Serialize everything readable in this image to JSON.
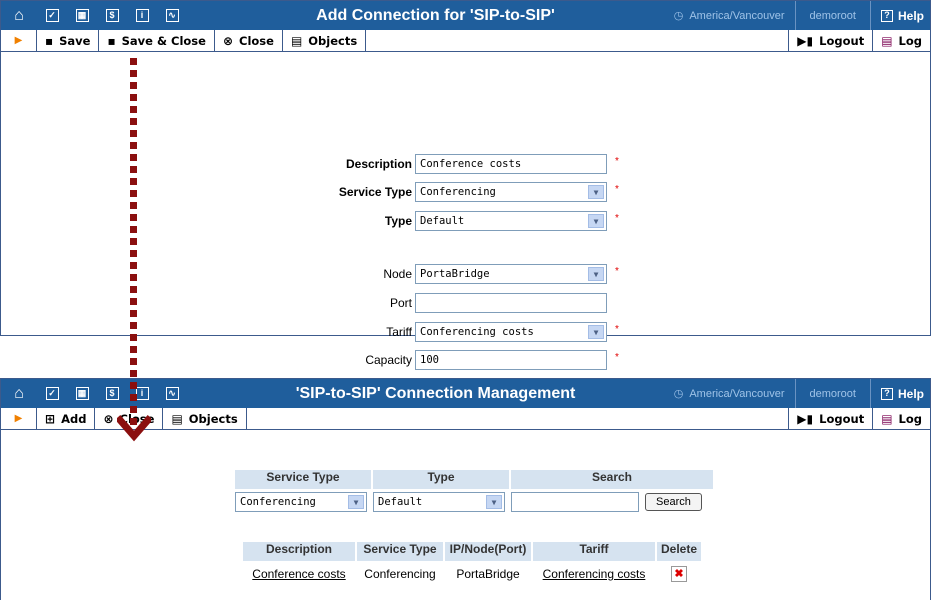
{
  "panel1": {
    "title": "Add Connection for 'SIP-to-SIP'",
    "timezone": "America/Vancouver",
    "user": "demoroot",
    "help": "Help",
    "toolbar": {
      "save": "Save",
      "save_close": "Save & Close",
      "close": "Close",
      "objects": "Objects",
      "logout": "Logout",
      "log": "Log"
    },
    "form": {
      "description_label": "Description",
      "description_value": "Conference costs",
      "service_type_label": "Service Type",
      "service_type_value": "Conferencing",
      "type_label": "Type",
      "type_value": "Default",
      "node_label": "Node",
      "node_value": "PortaBridge",
      "port_label": "Port",
      "port_value": "",
      "tariff_label": "Tariff",
      "tariff_value": "Conferencing costs",
      "capacity_label": "Capacity",
      "capacity_value": "100",
      "required_mark": "*"
    }
  },
  "panel2": {
    "title": "'SIP-to-SIP' Connection Management",
    "timezone": "America/Vancouver",
    "user": "demoroot",
    "help": "Help",
    "toolbar": {
      "add": "Add",
      "close": "Close",
      "objects": "Objects",
      "logout": "Logout",
      "log": "Log"
    },
    "filter": {
      "service_type_header": "Service Type",
      "type_header": "Type",
      "search_header": "Search",
      "service_type_value": "Conferencing",
      "type_value": "Default",
      "search_value": "",
      "search_button": "Search"
    },
    "results": {
      "headers": [
        "Description",
        "Service Type",
        "IP/Node(Port)",
        "Tariff",
        "Delete"
      ],
      "rows": [
        {
          "description": "Conference costs",
          "service_type": "Conferencing",
          "node": "PortaBridge",
          "tariff": "Conferencing costs"
        }
      ]
    }
  },
  "colors": {
    "header_bg": "#1f5e9c",
    "link_dots": "#8b0f0f",
    "required": "#e00000",
    "table_header": "#d6e3f0"
  }
}
